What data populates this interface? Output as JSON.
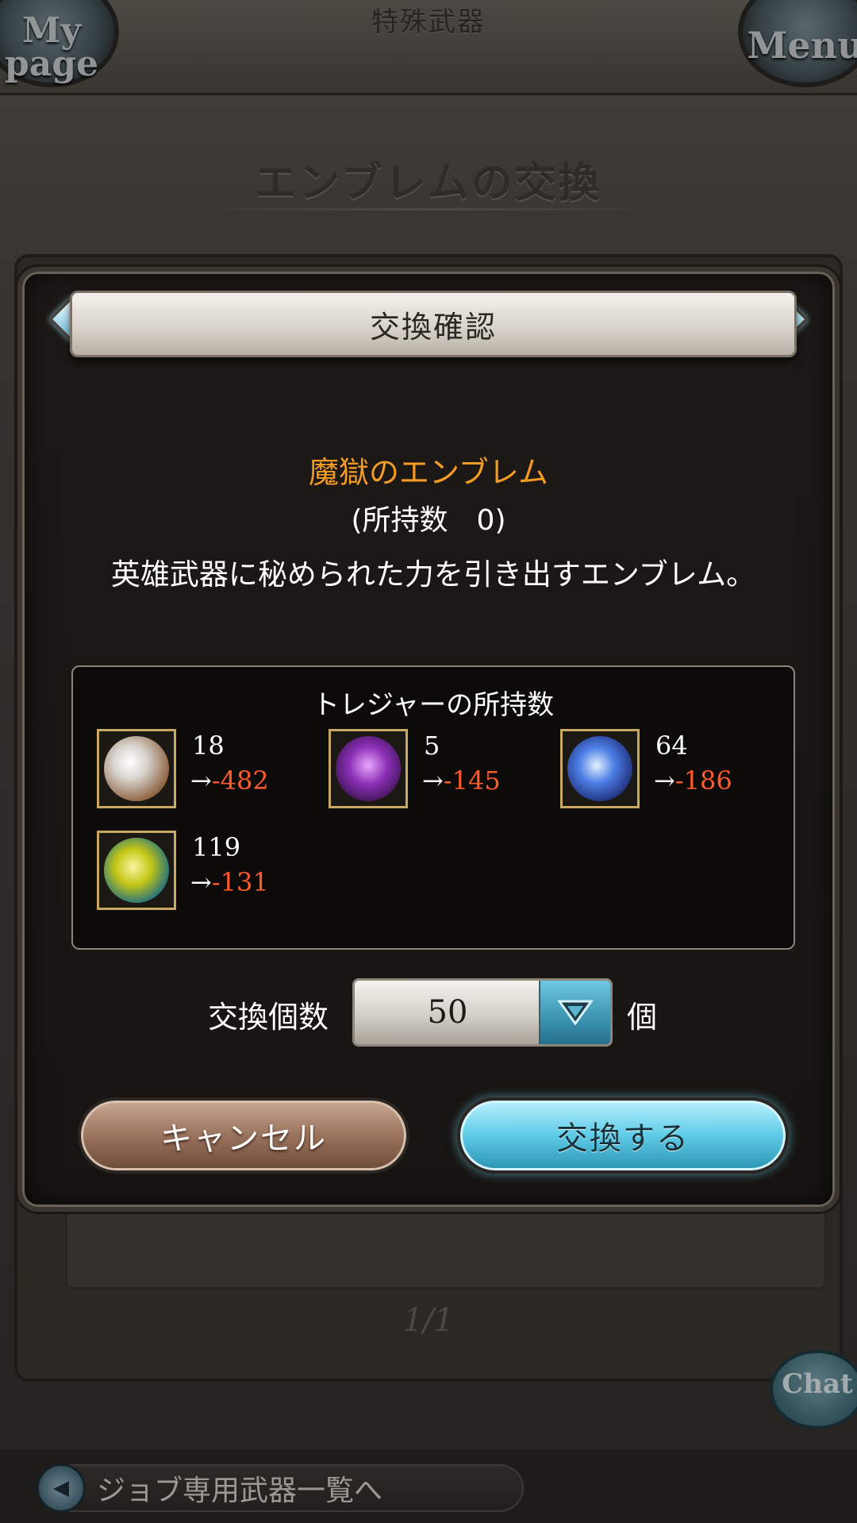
{
  "header": {
    "mypage_label_1": "My",
    "mypage_label_2": "page",
    "menu_label": "Menu",
    "section_title": "特殊武器"
  },
  "page": {
    "heading": "エンブレムの交換",
    "pager": "1/1"
  },
  "chat": {
    "label": "Chat"
  },
  "footer": {
    "back_label": "ジョブ専用武器一覧へ"
  },
  "dialog": {
    "title": "交換確認",
    "item_name": "魔獄のエンブレム",
    "owned": "(所持数　0)",
    "description": "英雄武器に秘められた力を引き出すエンブレム。",
    "treasure_title": "トレジャーの所持数",
    "treasures": [
      {
        "icon": "white-orb-icon",
        "quantity": "18",
        "after_prefix": "→",
        "after_value": "-482"
      },
      {
        "icon": "purple-crystal-icon",
        "quantity": "5",
        "after_prefix": "→",
        "after_value": "-145"
      },
      {
        "icon": "blue-orb-icon",
        "quantity": "64",
        "after_prefix": "→",
        "after_value": "-186"
      },
      {
        "icon": "yellow-orb-icon",
        "quantity": "119",
        "after_prefix": "→",
        "after_value": "-131"
      }
    ],
    "quantity_label": "交換個数",
    "quantity_value": "50",
    "quantity_unit": "個",
    "cancel_label": "キャンセル",
    "exchange_label": "交換する"
  },
  "colors": {
    "item_name": "#f39b25",
    "negative": "#ff5a2c",
    "exchange_button": "#5fcbe6",
    "cancel_button": "#9a735d"
  }
}
